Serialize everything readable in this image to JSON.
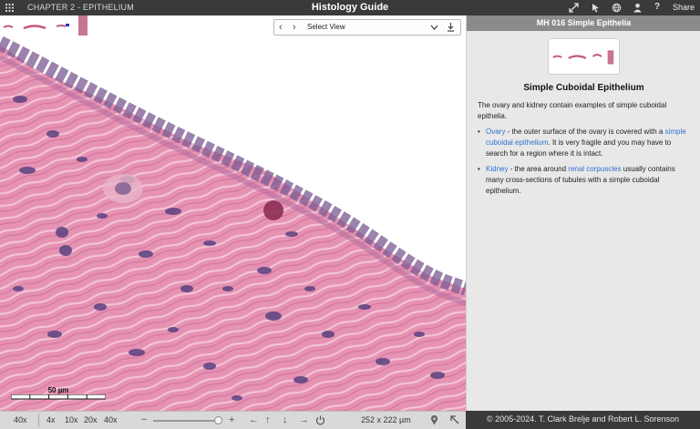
{
  "topbar": {
    "chapter": "CHAPTER 2 - EPITHELIUM",
    "title": "Histology Guide",
    "share_label": "Share",
    "icons": [
      "grid-icon",
      "fullscreen-icon",
      "pointer-icon",
      "globe-icon",
      "person-icon",
      "help-icon"
    ]
  },
  "viewer": {
    "select_view_label": "Select View",
    "scalebar_label": "50 µm",
    "tissue_colors": {
      "background": "#f6d9e6",
      "stroma": "#dd8aab",
      "nuclei": "#5e4482"
    }
  },
  "bottombar": {
    "current_mag": "40x",
    "zoom_levels": [
      "4x",
      "10x",
      "20x",
      "40x"
    ],
    "zoom_level_fraction": 1.0,
    "field_of_view": "252 x 222 µm"
  },
  "panel": {
    "header": "MH 016 Simple Epithelia",
    "title": "Simple Cuboidal Epithelium",
    "intro": "The ovary and kidney contain examples of simple cuboidal epithelia.",
    "items": [
      {
        "link": "Ovary",
        "text1": " - the outer surface of the ovary is covered with a ",
        "link2": "simple cuboidal epithelium",
        "text2": ". It is very fragile and you may have to search for a region where it is intact."
      },
      {
        "link": "Kidney",
        "text1": " - the area around ",
        "link2": "renal corpuscles",
        "text2": " usually contains many cross-sections of tubules with a simple cuboidal epithelium."
      }
    ]
  },
  "footer": {
    "copyright": "© 2005-2024. T. Clark Brelje and Robert L. Sorenson"
  }
}
